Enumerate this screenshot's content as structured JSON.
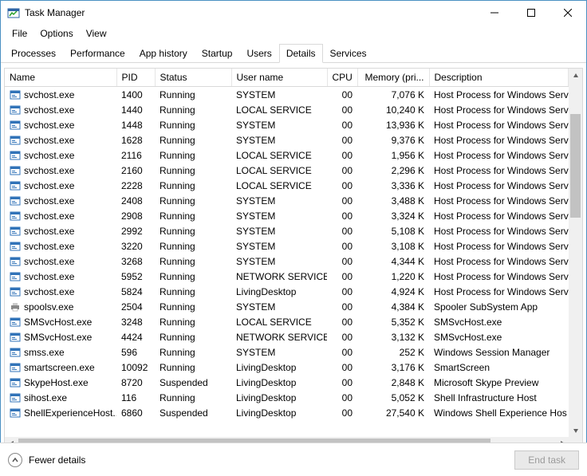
{
  "window": {
    "title": "Task Manager"
  },
  "menu": {
    "file": "File",
    "options": "Options",
    "view": "View"
  },
  "tabs": {
    "processes": "Processes",
    "performance": "Performance",
    "app_history": "App history",
    "startup": "Startup",
    "users": "Users",
    "details": "Details",
    "services": "Services",
    "active": "details"
  },
  "columns": {
    "name": "Name",
    "pid": "PID",
    "status": "Status",
    "user": "User name",
    "cpu": "CPU",
    "memory": "Memory (pri...",
    "description": "Description"
  },
  "rows": [
    {
      "icon": "app",
      "name": "svchost.exe",
      "pid": "1400",
      "status": "Running",
      "user": "SYSTEM",
      "cpu": "00",
      "mem": "7,076 K",
      "desc": "Host Process for Windows Serv"
    },
    {
      "icon": "app",
      "name": "svchost.exe",
      "pid": "1440",
      "status": "Running",
      "user": "LOCAL SERVICE",
      "cpu": "00",
      "mem": "10,240 K",
      "desc": "Host Process for Windows Serv"
    },
    {
      "icon": "app",
      "name": "svchost.exe",
      "pid": "1448",
      "status": "Running",
      "user": "SYSTEM",
      "cpu": "00",
      "mem": "13,936 K",
      "desc": "Host Process for Windows Serv"
    },
    {
      "icon": "app",
      "name": "svchost.exe",
      "pid": "1628",
      "status": "Running",
      "user": "SYSTEM",
      "cpu": "00",
      "mem": "9,376 K",
      "desc": "Host Process for Windows Serv"
    },
    {
      "icon": "app",
      "name": "svchost.exe",
      "pid": "2116",
      "status": "Running",
      "user": "LOCAL SERVICE",
      "cpu": "00",
      "mem": "1,956 K",
      "desc": "Host Process for Windows Serv"
    },
    {
      "icon": "app",
      "name": "svchost.exe",
      "pid": "2160",
      "status": "Running",
      "user": "LOCAL SERVICE",
      "cpu": "00",
      "mem": "2,296 K",
      "desc": "Host Process for Windows Serv"
    },
    {
      "icon": "app",
      "name": "svchost.exe",
      "pid": "2228",
      "status": "Running",
      "user": "LOCAL SERVICE",
      "cpu": "00",
      "mem": "3,336 K",
      "desc": "Host Process for Windows Serv"
    },
    {
      "icon": "app",
      "name": "svchost.exe",
      "pid": "2408",
      "status": "Running",
      "user": "SYSTEM",
      "cpu": "00",
      "mem": "3,488 K",
      "desc": "Host Process for Windows Serv"
    },
    {
      "icon": "app",
      "name": "svchost.exe",
      "pid": "2908",
      "status": "Running",
      "user": "SYSTEM",
      "cpu": "00",
      "mem": "3,324 K",
      "desc": "Host Process for Windows Serv"
    },
    {
      "icon": "app",
      "name": "svchost.exe",
      "pid": "2992",
      "status": "Running",
      "user": "SYSTEM",
      "cpu": "00",
      "mem": "5,108 K",
      "desc": "Host Process for Windows Serv"
    },
    {
      "icon": "app",
      "name": "svchost.exe",
      "pid": "3220",
      "status": "Running",
      "user": "SYSTEM",
      "cpu": "00",
      "mem": "3,108 K",
      "desc": "Host Process for Windows Serv"
    },
    {
      "icon": "app",
      "name": "svchost.exe",
      "pid": "3268",
      "status": "Running",
      "user": "SYSTEM",
      "cpu": "00",
      "mem": "4,344 K",
      "desc": "Host Process for Windows Serv"
    },
    {
      "icon": "app",
      "name": "svchost.exe",
      "pid": "5952",
      "status": "Running",
      "user": "NETWORK SERVICE",
      "cpu": "00",
      "mem": "1,220 K",
      "desc": "Host Process for Windows Serv"
    },
    {
      "icon": "app",
      "name": "svchost.exe",
      "pid": "5824",
      "status": "Running",
      "user": "LivingDesktop",
      "cpu": "00",
      "mem": "4,924 K",
      "desc": "Host Process for Windows Serv"
    },
    {
      "icon": "printer",
      "name": "spoolsv.exe",
      "pid": "2504",
      "status": "Running",
      "user": "SYSTEM",
      "cpu": "00",
      "mem": "4,384 K",
      "desc": "Spooler SubSystem App"
    },
    {
      "icon": "app",
      "name": "SMSvcHost.exe",
      "pid": "3248",
      "status": "Running",
      "user": "LOCAL SERVICE",
      "cpu": "00",
      "mem": "5,352 K",
      "desc": "SMSvcHost.exe"
    },
    {
      "icon": "app",
      "name": "SMSvcHost.exe",
      "pid": "4424",
      "status": "Running",
      "user": "NETWORK SERVICE",
      "cpu": "00",
      "mem": "3,132 K",
      "desc": "SMSvcHost.exe"
    },
    {
      "icon": "app",
      "name": "smss.exe",
      "pid": "596",
      "status": "Running",
      "user": "SYSTEM",
      "cpu": "00",
      "mem": "252 K",
      "desc": "Windows Session Manager"
    },
    {
      "icon": "app",
      "name": "smartscreen.exe",
      "pid": "10092",
      "status": "Running",
      "user": "LivingDesktop",
      "cpu": "00",
      "mem": "3,176 K",
      "desc": "SmartScreen"
    },
    {
      "icon": "app",
      "name": "SkypeHost.exe",
      "pid": "8720",
      "status": "Suspended",
      "user": "LivingDesktop",
      "cpu": "00",
      "mem": "2,848 K",
      "desc": "Microsoft Skype Preview"
    },
    {
      "icon": "app",
      "name": "sihost.exe",
      "pid": "116",
      "status": "Running",
      "user": "LivingDesktop",
      "cpu": "00",
      "mem": "5,052 K",
      "desc": "Shell Infrastructure Host"
    },
    {
      "icon": "app",
      "name": "ShellExperienceHost....",
      "pid": "6860",
      "status": "Suspended",
      "user": "LivingDesktop",
      "cpu": "00",
      "mem": "27,540 K",
      "desc": "Windows Shell Experience Hos"
    }
  ],
  "footer": {
    "fewer_details": "Fewer details",
    "end_task": "End task"
  }
}
